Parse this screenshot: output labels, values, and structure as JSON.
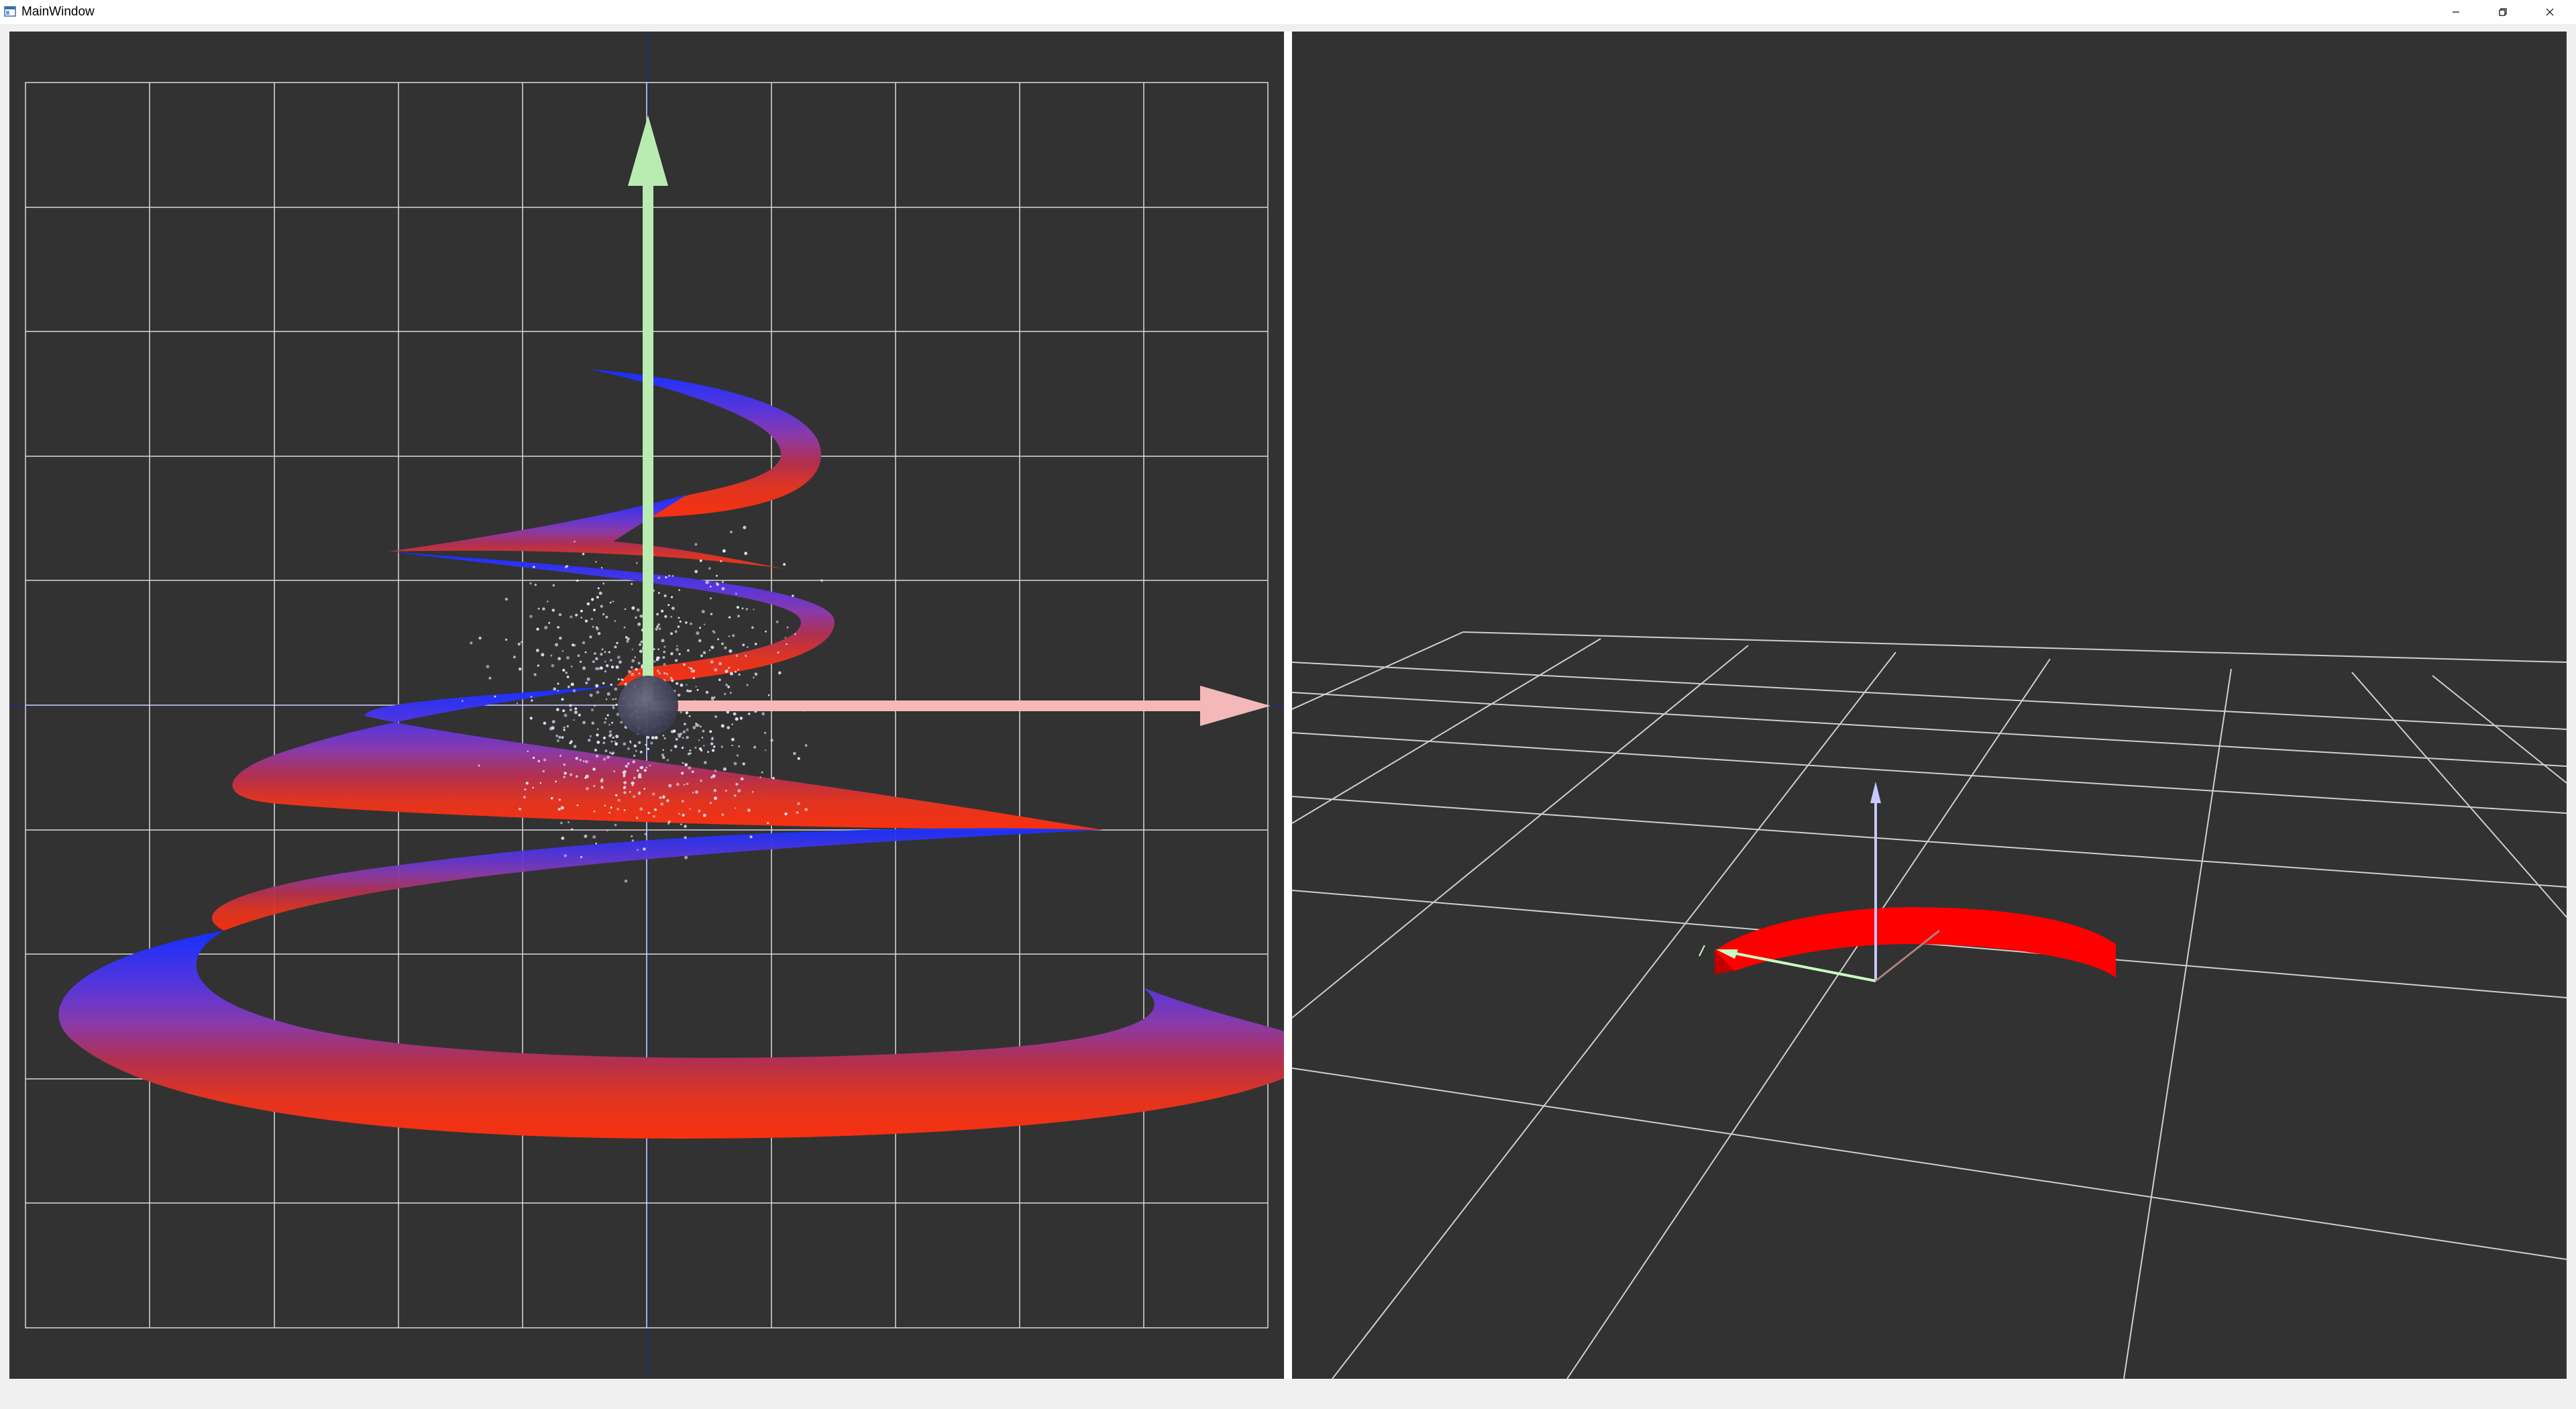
{
  "window": {
    "title": "MainWindow",
    "buttons": {
      "minimize": "minimize-icon",
      "restore": "restore-icon",
      "close": "close-icon"
    }
  },
  "left_view": {
    "name": "front-view-3d",
    "background": "#323232",
    "grid_color": "#d9d9d9",
    "axis_colors": {
      "x": "#f4b8b8",
      "y": "#b8ecb0"
    },
    "spiral_gradient": [
      "#1430ff",
      "#7a38c0",
      "#b4305a",
      "#f03012"
    ]
  },
  "right_view": {
    "name": "perspective-view-3d",
    "background": "#323232",
    "grid_color": "#cfcfcf",
    "ring_color": "#ff0000",
    "axis_colors": {
      "x": "#c8ffc0",
      "y": "#f0a0a0",
      "z": "#c8c8ff"
    }
  }
}
